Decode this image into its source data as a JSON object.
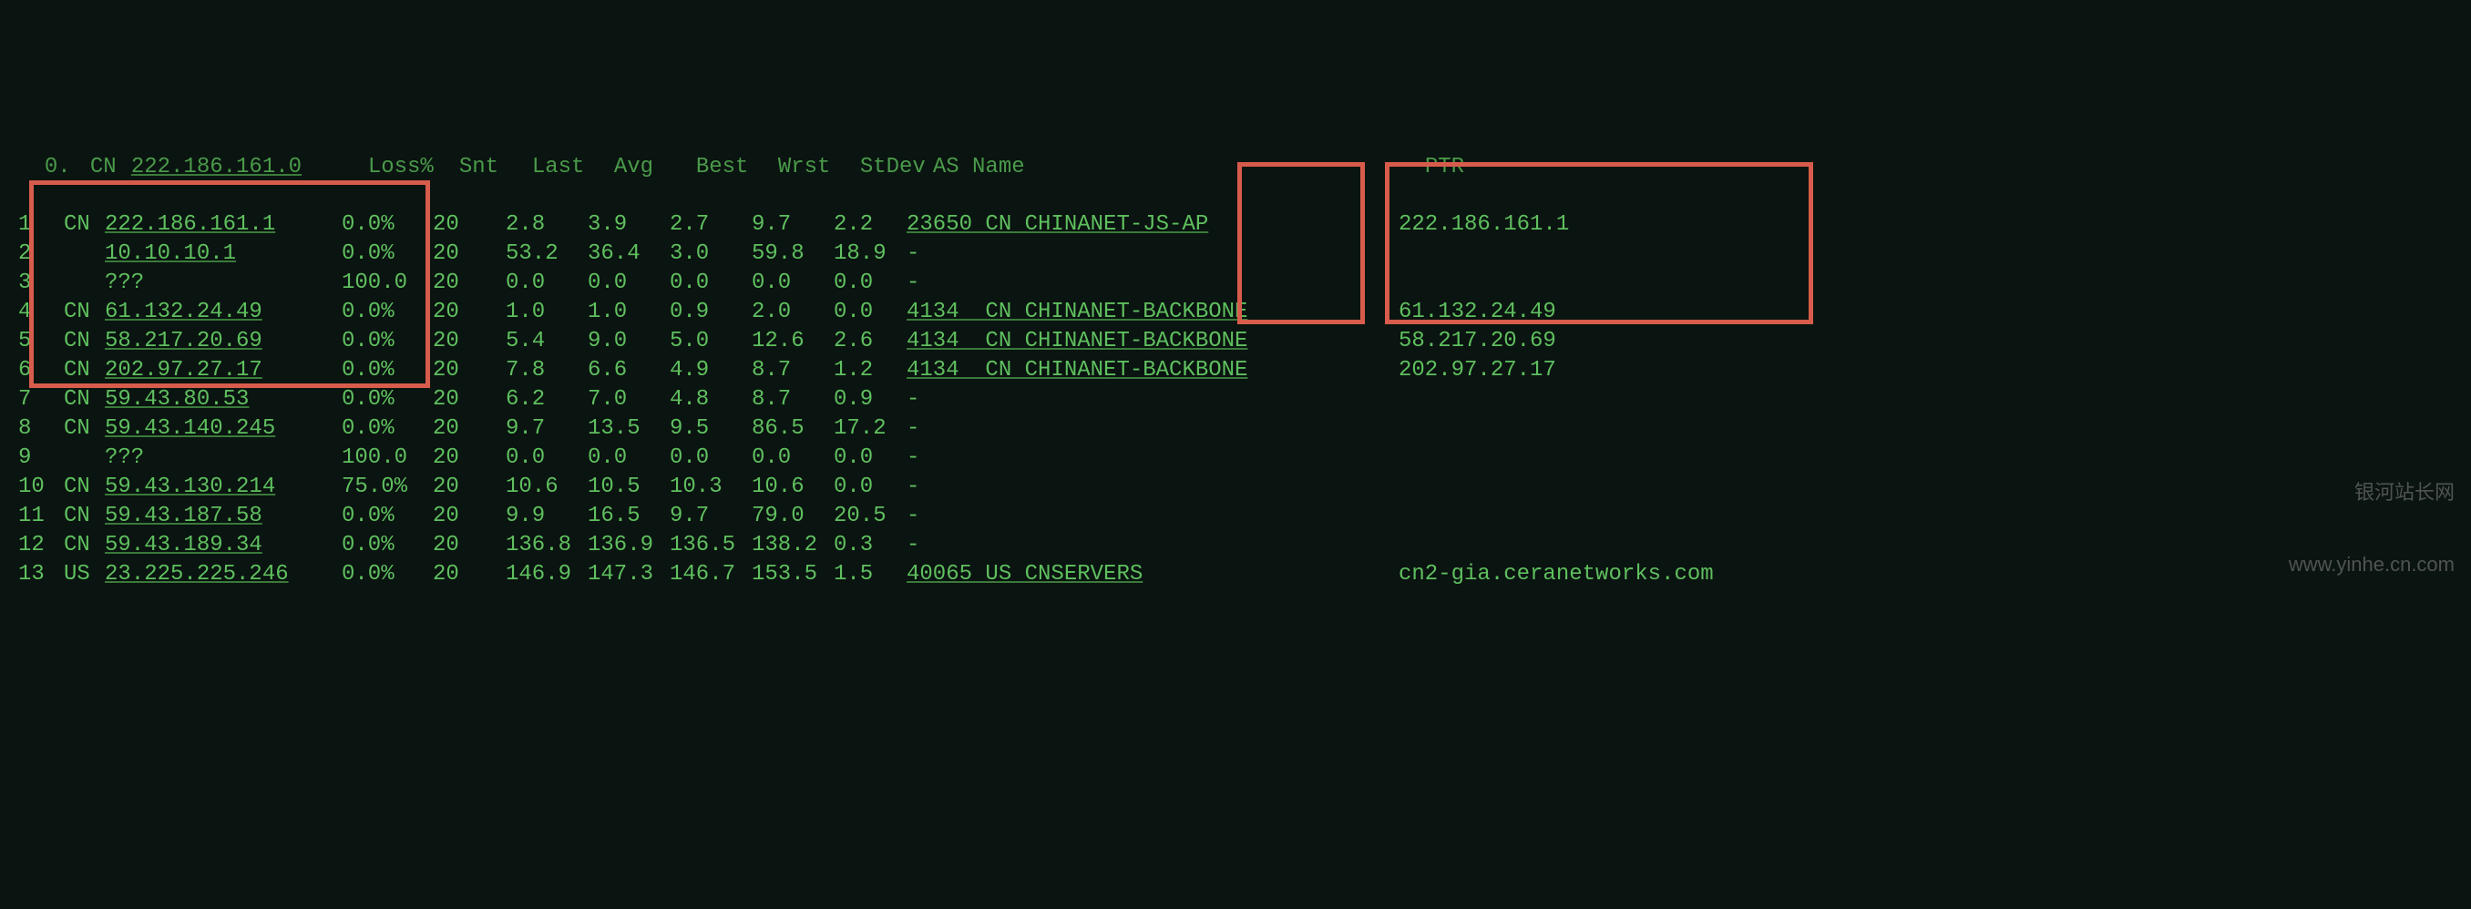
{
  "header": {
    "hop": "0.",
    "cc": "CN",
    "ip": "222.186.161.0",
    "loss": "Loss%",
    "snt": "Snt",
    "last": "Last",
    "avg": "Avg",
    "best": "Best",
    "wrst": "Wrst",
    "stdev": "StDev",
    "asname": "AS Name",
    "ptr": "PTR"
  },
  "rows": [
    {
      "hop": "1",
      "cc": "CN",
      "ip": "222.186.161.1",
      "loss": "0.0%",
      "snt": "20",
      "last": "2.8",
      "avg": "3.9",
      "best": "2.7",
      "wrst": "9.7",
      "stdev": "2.2",
      "asname": "23650 CN CHINANET-JS-AP",
      "ptr": "222.186.161.1"
    },
    {
      "hop": "2",
      "cc": "",
      "ip": "10.10.10.1",
      "loss": "0.0%",
      "snt": "20",
      "last": "53.2",
      "avg": "36.4",
      "best": "3.0",
      "wrst": "59.8",
      "stdev": "18.9",
      "asname": "-",
      "ptr": ""
    },
    {
      "hop": "3",
      "cc": "",
      "ip": "???",
      "loss": "100.0",
      "snt": "20",
      "last": "0.0",
      "avg": "0.0",
      "best": "0.0",
      "wrst": "0.0",
      "stdev": "0.0",
      "asname": "-",
      "ptr": ""
    },
    {
      "hop": "4",
      "cc": "CN",
      "ip": "61.132.24.49",
      "loss": "0.0%",
      "snt": "20",
      "last": "1.0",
      "avg": "1.0",
      "best": "0.9",
      "wrst": "2.0",
      "stdev": "0.0",
      "asname": "4134  CN CHINANET-BACKBONE",
      "ptr": "61.132.24.49"
    },
    {
      "hop": "5",
      "cc": "CN",
      "ip": "58.217.20.69",
      "loss": "0.0%",
      "snt": "20",
      "last": "5.4",
      "avg": "9.0",
      "best": "5.0",
      "wrst": "12.6",
      "stdev": "2.6",
      "asname": "4134  CN CHINANET-BACKBONE",
      "ptr": "58.217.20.69"
    },
    {
      "hop": "6",
      "cc": "CN",
      "ip": "202.97.27.17",
      "loss": "0.0%",
      "snt": "20",
      "last": "7.8",
      "avg": "6.6",
      "best": "4.9",
      "wrst": "8.7",
      "stdev": "1.2",
      "asname": "4134  CN CHINANET-BACKBONE",
      "ptr": "202.97.27.17"
    },
    {
      "hop": "7",
      "cc": "CN",
      "ip": "59.43.80.53",
      "loss": "0.0%",
      "snt": "20",
      "last": "6.2",
      "avg": "7.0",
      "best": "4.8",
      "wrst": "8.7",
      "stdev": "0.9",
      "asname": "-",
      "ptr": ""
    },
    {
      "hop": "8",
      "cc": "CN",
      "ip": "59.43.140.245",
      "loss": "0.0%",
      "snt": "20",
      "last": "9.7",
      "avg": "13.5",
      "best": "9.5",
      "wrst": "86.5",
      "stdev": "17.2",
      "asname": "-",
      "ptr": ""
    },
    {
      "hop": "9",
      "cc": "",
      "ip": "???",
      "loss": "100.0",
      "snt": "20",
      "last": "0.0",
      "avg": "0.0",
      "best": "0.0",
      "wrst": "0.0",
      "stdev": "0.0",
      "asname": "-",
      "ptr": ""
    },
    {
      "hop": "10",
      "cc": "CN",
      "ip": "59.43.130.214",
      "loss": "75.0%",
      "snt": "20",
      "last": "10.6",
      "avg": "10.5",
      "best": "10.3",
      "wrst": "10.6",
      "stdev": "0.0",
      "asname": "-",
      "ptr": ""
    },
    {
      "hop": "11",
      "cc": "CN",
      "ip": "59.43.187.58",
      "loss": "0.0%",
      "snt": "20",
      "last": "9.9",
      "avg": "16.5",
      "best": "9.7",
      "wrst": "79.0",
      "stdev": "20.5",
      "asname": "-",
      "ptr": ""
    },
    {
      "hop": "12",
      "cc": "CN",
      "ip": "59.43.189.34",
      "loss": "0.0%",
      "snt": "20",
      "last": "136.8",
      "avg": "136.9",
      "best": "136.5",
      "wrst": "138.2",
      "stdev": "0.3",
      "asname": "-",
      "ptr": ""
    },
    {
      "hop": "13",
      "cc": "US",
      "ip": "23.225.225.246",
      "loss": "0.0%",
      "snt": "20",
      "last": "146.9",
      "avg": "147.3",
      "best": "146.7",
      "wrst": "153.5",
      "stdev": "1.5",
      "asname": "40065 US CNSERVERS",
      "ptr": "cn2-gia.ceranetworks.com"
    }
  ],
  "watermark": {
    "line1": "银河站长网",
    "line2": "www.yinhe.cn.com"
  }
}
